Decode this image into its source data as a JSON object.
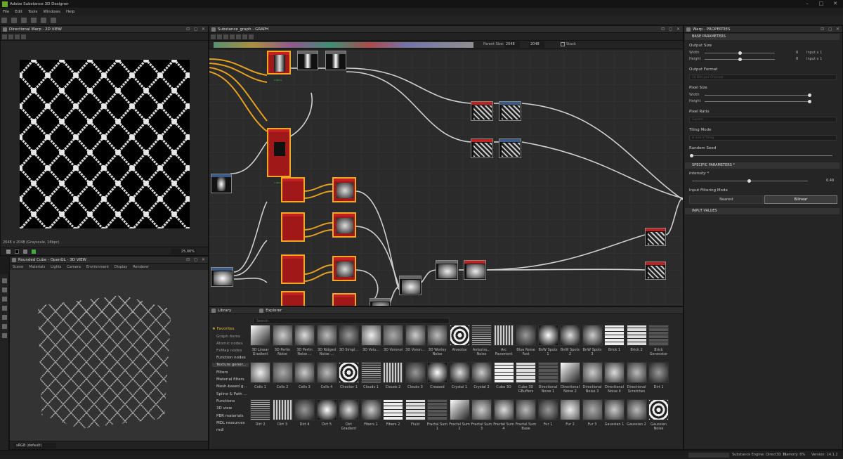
{
  "app": {
    "title": "Adobe Substance 3D Designer"
  },
  "menu": [
    "File",
    "Edit",
    "Tools",
    "Windows",
    "Help"
  ],
  "view2d": {
    "title": "Directional Warp - 2D VIEW",
    "info": "2048 x 2048 (Grayscale, 16bpc)",
    "zoom": "25.00%"
  },
  "view3d": {
    "title": "Rounded Cube - OpenGL - 3D VIEW",
    "menu": [
      "Scene",
      "Materials",
      "Lights",
      "Camera",
      "Environment",
      "Display",
      "Renderer"
    ],
    "colorspace": "sRGB (default)"
  },
  "graph": {
    "title": "Substance_graph - GRAPH",
    "parent_size_label": "Parent Size:",
    "parent_size": "2048",
    "size": "2048",
    "stack_label": "Stack"
  },
  "library": {
    "tabs": [
      "Library",
      "Explorer"
    ],
    "search_placeholder": "Search",
    "categories": [
      "Favorites",
      "Graph items",
      "Atomic nodes",
      "FxMap nodes",
      "Function nodes",
      "Texture gener...",
      "Filters",
      "Material filters",
      "Mesh-based g...",
      "Spline & Path ...",
      "Functions",
      "3D view",
      "PBR materials",
      "MDL resources",
      "mdl"
    ],
    "items_row1": [
      "3D Linear Gradient",
      "3D Perlin Noise",
      "3D Perlin Noise ...",
      "3D Ridged Noise ...",
      "3D Simpl...",
      "3D Volu...",
      "3D Voronoi",
      "3D Voron...",
      "3D Worley Noise",
      "Alveolus",
      "Anisotro... Noise",
      "Arc Pavement",
      "Blue Noise Fast",
      "BnW Spots 1",
      "BnW Spots 2",
      "BnW Spots 3",
      "Brick 1",
      "Brick 2",
      "Brick Generator"
    ],
    "items_row2": [
      "Cells 1",
      "Cells 2",
      "Cells 3",
      "Cells 4",
      "Checker 1",
      "Clouds 1",
      "Clouds 2",
      "Clouds 3",
      "Creased",
      "Crystal 1",
      "Crystal 2",
      "Cube 3D",
      "Cube 3D GBuffers",
      "Directional Noise 1",
      "Directional Noise 2",
      "Directional Noise 3",
      "Directional Noise 4",
      "Directional Scratches",
      "Dirt 1"
    ],
    "items_row3": [
      "Dirt 2",
      "Dirt 3",
      "Dirt 4",
      "Dirt 5",
      "Dirt Gradient",
      "Fibers 1",
      "Fibers 2",
      "Fluid",
      "Fractal Sum 1",
      "Fractal Sum 2",
      "Fractal Sum 3",
      "Fractal Sum 4",
      "Fractal Sum Base",
      "Fur 1",
      "Fur 2",
      "Fur 3",
      "Gaussian 1",
      "Gaussian 2",
      "Gaussian Noise"
    ]
  },
  "properties": {
    "title": "Warp - PROPERTIES",
    "base_section": "BASE PARAMETERS",
    "output_size": "Output Size",
    "width": "Width",
    "height": "Height",
    "width_val": "0",
    "height_val": "0",
    "input_x1_a": "Input x 1",
    "input_x1_b": "Input x 1",
    "output_format": "Output Format",
    "output_format_val": "16 Bits per Channel",
    "pixel_size": "Pixel Size",
    "pixel_ratio": "Pixel Ratio",
    "pixel_ratio_val": "Square",
    "tiling_mode": "Tiling Mode",
    "tiling_mode_val": "H and V Tiling",
    "random_seed": "Random Seed",
    "specific_section": "SPECIFIC PARAMETERS *",
    "intensity": "Intensity *",
    "intensity_val": "0.49",
    "intensity_frac": 0.49,
    "filter_mode": "Input Filtering Mode",
    "filter_nearest": "Nearest",
    "filter_bilinear": "Bilinear",
    "input_values": "INPUT VALUES"
  },
  "status": {
    "engine": "Substance Engine: Direct3D 11",
    "memory": "Memory: 6%",
    "version": "Version: 14.1.2"
  }
}
